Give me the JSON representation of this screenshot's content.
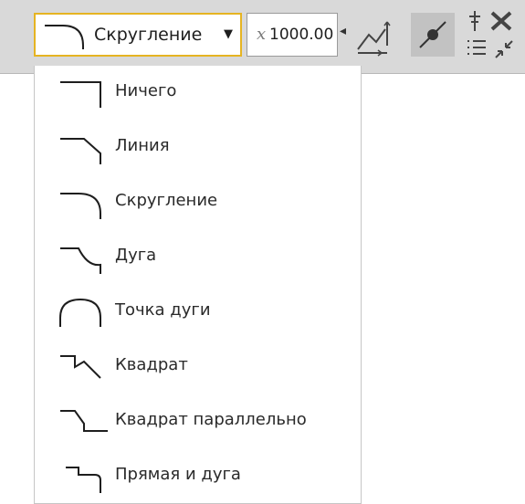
{
  "toolbar": {
    "selected_label": "Скругление",
    "caret": "▼",
    "value_prefix": "x",
    "value": "1000.00",
    "left_arrow": "◂",
    "icons": [
      "fillet-icon",
      "scale-dimension-icon",
      "point-snap-icon",
      "pin-icon",
      "close-icon",
      "list-icon",
      "collapse-icon"
    ]
  },
  "menu": {
    "items": [
      {
        "label": "Ничего",
        "icon": "corner-none-icon"
      },
      {
        "label": "Линия",
        "icon": "corner-line-icon"
      },
      {
        "label": "Скругление",
        "icon": "corner-fillet-icon"
      },
      {
        "label": "Дуга",
        "icon": "corner-arc-icon"
      },
      {
        "label": "Точка дуги",
        "icon": "corner-arc-point-icon"
      },
      {
        "label": "Квадрат",
        "icon": "corner-square-icon"
      },
      {
        "label": "Квадрат параллельно",
        "icon": "corner-square-parallel-icon"
      },
      {
        "label": "Прямая и дуга",
        "icon": "corner-line-arc-icon"
      }
    ]
  }
}
